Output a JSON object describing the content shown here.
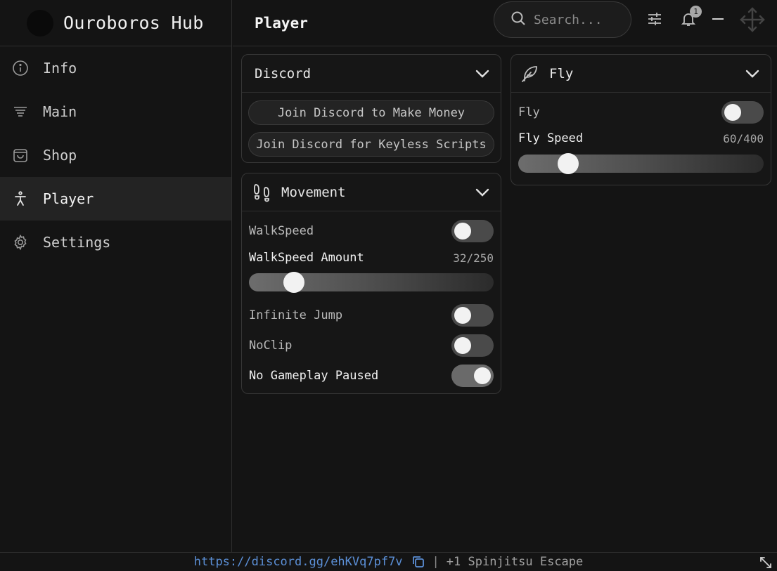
{
  "app": {
    "title": "Ouroboros Hub"
  },
  "sidebar": {
    "items": [
      {
        "label": "Info",
        "icon": "info-icon"
      },
      {
        "label": "Main",
        "icon": "list-icon"
      },
      {
        "label": "Shop",
        "icon": "bag-icon"
      },
      {
        "label": "Player",
        "icon": "person-icon",
        "active": true
      },
      {
        "label": "Settings",
        "icon": "gear-icon"
      }
    ]
  },
  "header": {
    "title": "Player",
    "search_placeholder": "Search...",
    "notification_count": "1"
  },
  "discord": {
    "title": "Discord",
    "buttons": [
      "Join Discord to Make Money",
      "Join Discord for Keyless Scripts"
    ]
  },
  "movement": {
    "title": "Movement",
    "walkspeed_label": "WalkSpeed",
    "walkspeed_on": false,
    "walkspeed_amount_label": "WalkSpeed Amount",
    "walkspeed_amount_value": 32,
    "walkspeed_amount_max": 250,
    "walkspeed_amount_text": "32/250",
    "infinite_jump_label": "Infinite Jump",
    "infinite_jump_on": false,
    "noclip_label": "NoClip",
    "noclip_on": false,
    "no_gameplay_paused_label": "No Gameplay Paused",
    "no_gameplay_paused_on": true
  },
  "fly": {
    "title": "Fly",
    "fly_label": "Fly",
    "fly_on": false,
    "speed_label": "Fly Speed",
    "speed_value": 60,
    "speed_max": 400,
    "speed_text": "60/400"
  },
  "footer": {
    "link": "https://discord.gg/ehKVq7pf7v",
    "separator": "|",
    "note": "+1 Spinjitsu Escape"
  },
  "colors": {
    "accent_link": "#5b8fd6",
    "background": "#141414"
  }
}
